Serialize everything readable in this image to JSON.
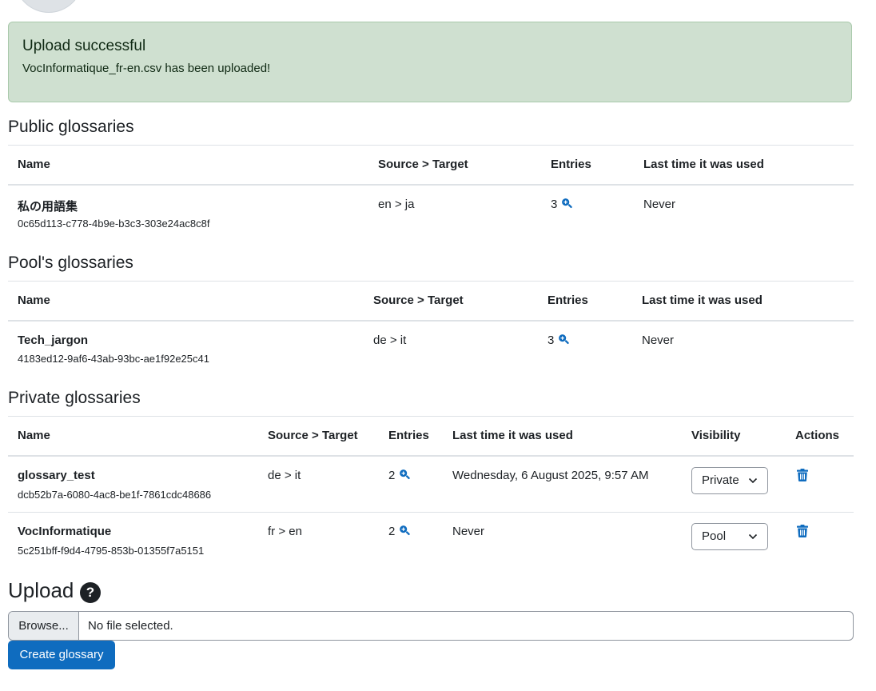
{
  "alert": {
    "title": "Upload successful",
    "message": "VocInformatique_fr-en.csv has been uploaded!"
  },
  "public": {
    "heading": "Public glossaries",
    "headers": {
      "name": "Name",
      "source_target": "Source > Target",
      "entries": "Entries",
      "last_used": "Last time it was used"
    },
    "rows": [
      {
        "name": "私の用語集",
        "id": "0c65d113-c778-4b9e-b3c3-303e24ac8c8f",
        "source_target": "en > ja",
        "entries": "3",
        "last_used": "Never"
      }
    ]
  },
  "pool": {
    "heading": "Pool's glossaries",
    "headers": {
      "name": "Name",
      "source_target": "Source > Target",
      "entries": "Entries",
      "last_used": "Last time it was used"
    },
    "rows": [
      {
        "name": "Tech_jargon",
        "id": "4183ed12-9af6-43ab-93bc-ae1f92e25c41",
        "source_target": "de > it",
        "entries": "3",
        "last_used": "Never"
      }
    ]
  },
  "private": {
    "heading": "Private glossaries",
    "headers": {
      "name": "Name",
      "source_target": "Source > Target",
      "entries": "Entries",
      "last_used": "Last time it was used",
      "visibility": "Visibility",
      "actions": "Actions"
    },
    "rows": [
      {
        "name": "glossary_test",
        "id": "dcb52b7a-6080-4ac8-be1f-7861cdc48686",
        "source_target": "de > it",
        "entries": "2",
        "last_used": "Wednesday, 6 August 2025, 9:57 AM",
        "visibility": "Private"
      },
      {
        "name": "VocInformatique",
        "id": "5c251bff-f9d4-4795-853b-01355f7a5151",
        "source_target": "fr > en",
        "entries": "2",
        "last_used": "Never",
        "visibility": "Pool"
      }
    ]
  },
  "upload": {
    "heading": "Upload",
    "help_icon": "?",
    "browse_label": "Browse...",
    "file_status": "No file selected.",
    "submit_label": "Create glossary"
  },
  "icons": {
    "entries": "search-plus-icon",
    "delete": "trash-icon",
    "select": "chevron-down-icon",
    "help": "question-circle-icon"
  },
  "colors": {
    "primary": "#0f6cbf",
    "alert_bg": "#cfe0d0",
    "alert_border": "#a9c9ab"
  }
}
